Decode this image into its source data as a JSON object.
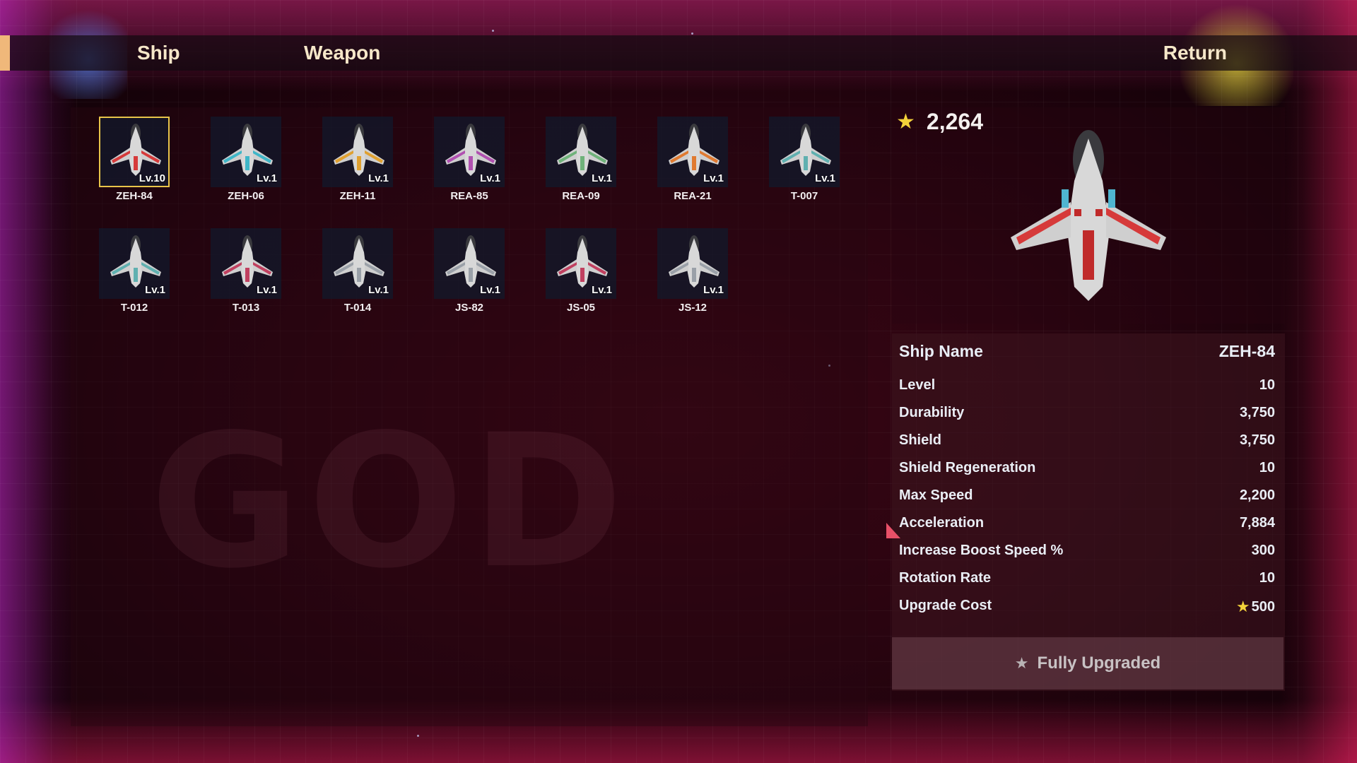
{
  "tabs": {
    "ship": "Ship",
    "weapon": "Weapon",
    "return": "Return"
  },
  "currency": {
    "amount": "2,264",
    "icon": "star-icon"
  },
  "ships": [
    {
      "name": "ZEH-84",
      "level": "Lv.10",
      "selected": true,
      "color": "#d63a3a"
    },
    {
      "name": "ZEH-06",
      "level": "Lv.1",
      "selected": false,
      "color": "#3fb6c8"
    },
    {
      "name": "ZEH-11",
      "level": "Lv.1",
      "selected": false,
      "color": "#e0a030"
    },
    {
      "name": "REA-85",
      "level": "Lv.1",
      "selected": false,
      "color": "#b050b0"
    },
    {
      "name": "REA-09",
      "level": "Lv.1",
      "selected": false,
      "color": "#6fb27a"
    },
    {
      "name": "REA-21",
      "level": "Lv.1",
      "selected": false,
      "color": "#e07a30"
    },
    {
      "name": "T-007",
      "level": "Lv.1",
      "selected": false,
      "color": "#5fb0b0"
    },
    {
      "name": "T-012",
      "level": "Lv.1",
      "selected": false,
      "color": "#5fb0b0"
    },
    {
      "name": "T-013",
      "level": "Lv.1",
      "selected": false,
      "color": "#c04060"
    },
    {
      "name": "T-014",
      "level": "Lv.1",
      "selected": false,
      "color": "#9aa0a8"
    },
    {
      "name": "JS-82",
      "level": "Lv.1",
      "selected": false,
      "color": "#9aa0a8"
    },
    {
      "name": "JS-05",
      "level": "Lv.1",
      "selected": false,
      "color": "#c04060"
    },
    {
      "name": "JS-12",
      "level": "Lv.1",
      "selected": false,
      "color": "#9aa0a8"
    }
  ],
  "details": {
    "ship_name_label": "Ship Name",
    "ship_name_value": "ZEH-84",
    "stats": [
      {
        "label": "Level",
        "value": "10"
      },
      {
        "label": "Durability",
        "value": "3,750"
      },
      {
        "label": "Shield",
        "value": "3,750"
      },
      {
        "label": "Shield Regeneration",
        "value": "10"
      },
      {
        "label": "Max Speed",
        "value": "2,200"
      },
      {
        "label": "Acceleration",
        "value": "7,884"
      },
      {
        "label": "Increase Boost Speed %",
        "value": "300"
      },
      {
        "label": "Rotation Rate",
        "value": "10"
      }
    ],
    "upgrade_cost_label": "Upgrade Cost",
    "upgrade_cost_value": "500"
  },
  "upgrade_button": "Fully Upgraded",
  "colors": {
    "accent": "#f0b87a",
    "selected_border": "#e8c54a",
    "star": "#f3d23a"
  }
}
